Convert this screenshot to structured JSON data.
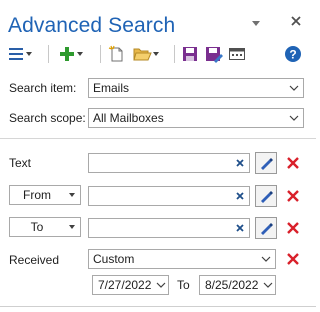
{
  "header": {
    "title": "Advanced Search"
  },
  "toolbar": {
    "icons": [
      "list-menu-icon",
      "add-icon",
      "new-search-icon",
      "open-folder-icon",
      "save-icon",
      "save-as-icon",
      "layout-icon",
      "help-icon"
    ]
  },
  "fields": {
    "search_item": {
      "label": "Search item:",
      "value": "Emails"
    },
    "search_scope": {
      "label": "Search scope:",
      "value": "All Mailboxes"
    },
    "text": {
      "label": "Text",
      "value": ""
    },
    "from": {
      "label": "From",
      "value": ""
    },
    "to": {
      "label": "To",
      "value": ""
    },
    "received": {
      "label": "Received",
      "value": "Custom"
    },
    "date_range": {
      "start": "7/27/2022",
      "separator": "To",
      "end": "8/25/2022"
    }
  },
  "colors": {
    "title": "#1f63b5",
    "add": "#2e9a2e",
    "delete": "#d9202a",
    "help": "#1f63b5",
    "save": "#7a2f8f"
  }
}
